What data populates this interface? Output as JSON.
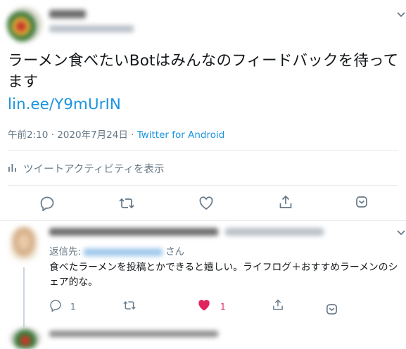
{
  "tweet": {
    "text": "ラーメン食べたいBotはみんなのフィードバックを待ってます",
    "link": "lin.ee/Y9mUrIN",
    "meta_prefix": "午前2:10 · 2020年7月24日 · ",
    "source": "Twitter for Android",
    "activity_label": "ツイートアクティビティを表示"
  },
  "reply": {
    "reply_to_prefix": "返信先:",
    "reply_to_suffix": "さん",
    "text": "食べたラーメンを投稿とかできると嬉しい。ライフログ＋おすすめラーメンのシェア的な。",
    "reply_count": "1",
    "like_count": "1"
  },
  "icons": {
    "reply": "reply-icon",
    "retweet": "retweet-icon",
    "like": "heart-icon",
    "share": "share-icon",
    "more": "chevron-down-icon",
    "stats": "stats-icon"
  },
  "colors": {
    "link": "#1b95e0",
    "secondary": "#657786",
    "like": "#e0245e",
    "divider": "#e6ecf0"
  }
}
